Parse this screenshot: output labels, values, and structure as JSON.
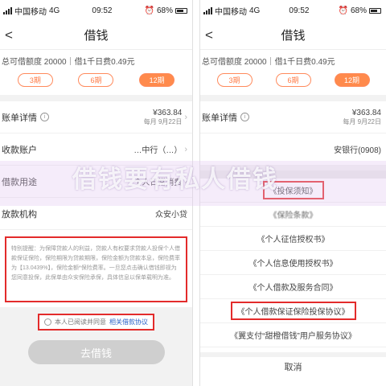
{
  "left": {
    "status": {
      "carrier": "中国移动",
      "network": "4G",
      "time": "09:52",
      "battery": "68%"
    },
    "title": "借钱",
    "quota_text": "总可借额度 20000｜借1千日费0.49元",
    "periods": [
      "3期",
      "6期",
      "12期"
    ],
    "active_period": "12期",
    "bill": {
      "label": "账单详情",
      "amount": "¥363.84",
      "sub": "每月 9月22日"
    },
    "account": {
      "label": "收款账户",
      "value": "…中行（…）"
    },
    "purpose": {
      "label": "借款用途",
      "value": "个人日常消费"
    },
    "institution": {
      "label": "放款机构",
      "value": "众安小贷"
    },
    "notice": "特别提醒：为保障贷款人的利益，贷款人有权要求贷款人投保个人借款保证保险，保险期限为贷款期限，保险金额为贷款本息，保险费率为【13.0439%】，保险金额*保险费率。一旦您点击确认借钱即视为您同意投保，此保单由众安保险承保，具体信息以保单载明为准。",
    "agree_text": "本人已阅读并同意",
    "agree_link": "相关借款协议",
    "borrow_button": "去借钱"
  },
  "right": {
    "status": {
      "carrier": "中国移动",
      "network": "4G",
      "time": "09:52",
      "battery": "68%"
    },
    "title": "借钱",
    "quota_text": "总可借额度 20000｜借1千日费0.49元",
    "periods": [
      "3期",
      "6期",
      "12期"
    ],
    "active_period": "12期",
    "bill": {
      "label": "账单详情",
      "amount": "¥363.84",
      "sub": "每月 9月22日"
    },
    "account_value": "安银行(0908)",
    "sheet_items": [
      "《投保须知》",
      "《保险条款》",
      "《个人征信授权书》",
      "《个人信息使用授权书》",
      "《个人借款及服务合同》",
      "《个人借款保证保险投保协议》",
      "《翼支付“甜橙借钱”用户服务协议》"
    ],
    "cancel": "取消"
  },
  "watermark": "借钱要有私人借钱",
  "colors": {
    "accent": "#ff8a4c",
    "highlight_box": "#e32b2b",
    "link": "#2a62c9",
    "disabled_button": "#cfcfcf"
  }
}
